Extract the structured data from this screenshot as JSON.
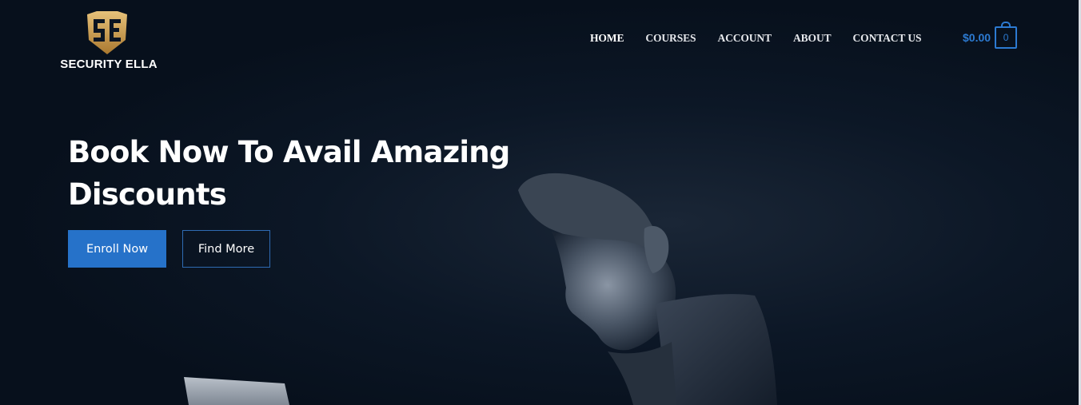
{
  "brand": {
    "name": "SECURITY ELLA",
    "logo_icon": "se-monogram-shield-icon",
    "logo_color": "#c99a46"
  },
  "nav": {
    "items": [
      {
        "label": "HOME",
        "active": true
      },
      {
        "label": "COURSES",
        "active": false
      },
      {
        "label": "ACCOUNT",
        "active": false
      },
      {
        "label": "ABOUT",
        "active": false
      },
      {
        "label": "CONTACT US",
        "active": false
      }
    ]
  },
  "cart": {
    "total": "$0.00",
    "count": "0",
    "icon": "shopping-bag-icon",
    "accent_color": "#2c7ad1"
  },
  "hero": {
    "headline_line1": "Book Now To Avail Amazing",
    "headline_line2": "Discounts",
    "primary_button": "Enroll Now",
    "secondary_button": "Find More",
    "background_image": "man-at-laptop-in-dark-photo",
    "button_color": "#2672c9"
  }
}
